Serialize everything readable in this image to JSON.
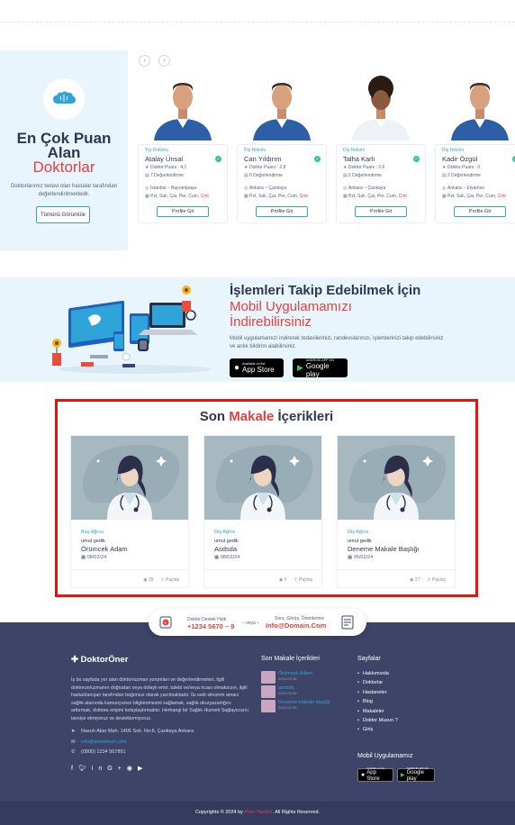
{
  "top_doctors": {
    "title_line1": "En Çok Puan",
    "title_line2": "Alan",
    "title_line3": "Doktorlar",
    "description": "Doktorlarımız tedavi olan hastalar tarafından değerlendirilmektedir.",
    "view_all": "Tümünü Görüntüle",
    "prev_arrow": "‹",
    "next_arrow": "›",
    "doctors": [
      {
        "specialty": "Tıp Doktoru",
        "name": "Atalay Ünsal",
        "score": "Doktor Puanı : 4.1",
        "reviews": "7 Değerlendirme",
        "location": "İstanbul – Bayrampaşa",
        "days": "Pzt, Salı, Çar, Per, Cum,",
        "days_off": "Cmt",
        "button": "Profile Git"
      },
      {
        "specialty": "Diş Hekimi",
        "name": "Can Yıldırım",
        "score": "Doktor Puanı : 2.9",
        "reviews": "0 Değerlendirme",
        "location": "Ankara – Çankaya",
        "days": "Pzt, Salı, Çar, Per, Cum,",
        "days_off": "Cmt",
        "button": "Profile Git"
      },
      {
        "specialty": "Diş Hekimi",
        "name": "Talha Karlı",
        "score": "Doktor Puanı : 2.6",
        "reviews": "2 Değerlendirme",
        "location": "Ankara – Çankaya",
        "days": "Pzt, Salı, Çar, Per, Cum,",
        "days_off": "Cmt",
        "button": "Profile Git"
      },
      {
        "specialty": "Diş Hekimi",
        "name": "Kadir Özgül",
        "score": "Doktor Puanı : 0",
        "reviews": "2 Değerlendirme",
        "location": "Ankara – Etyamon",
        "days": "Pzt, Salı, Çar, Per, Cum,",
        "days_off": "Cmt",
        "button": "Profile Git"
      }
    ]
  },
  "app_promo": {
    "title": "İşlemleri Takip Edebilmek İçin",
    "subtitle": "Mobil Uygulamamızı İndirebilirsiniz",
    "description": "Mobil uygulamamızı indirerek tedavilerinizi, randevularınızı, işlemlerinizi takip edebilirsiniz ve anlık bildirim alabilirsiniz.",
    "app_store_small": "Available on the",
    "app_store": "App Store",
    "google_play_small": "ANDROID APP ON",
    "google_play": "Google play"
  },
  "articles": {
    "title_pre": "Son",
    "title_highlight": "Makale",
    "title_post": "İçerikleri",
    "items": [
      {
        "category": "Baş Ağrısı",
        "author": "umut gedik",
        "title": "Örümcek Adam",
        "date": "08/02/24",
        "views": "39",
        "share": "Paylaş"
      },
      {
        "category": "Diş Ağrısı",
        "author": "umut gedik",
        "title": "Asdsda",
        "date": "08/02/24",
        "views": "0",
        "share": "Paylaş"
      },
      {
        "category": "Diş Ağrısı",
        "author": "umut gedik",
        "title": "Deneme Makale Başlığı",
        "date": "05/02/24",
        "views": "27",
        "share": "Paylaş"
      }
    ]
  },
  "support": {
    "hotline_label": "Doktor Destek Hattı",
    "hotline_number": "+1234 5670 – 9",
    "separator": "– veya –",
    "email_label": "Soru, Görüş, Önerileriniz",
    "email": "Info@Domain.Com"
  },
  "footer": {
    "logo": "DoktorÖner",
    "about": "İş bu sayfada yer alan doktor/uzman yorumları ve değerlendirmeleri, ilgili doktorun/uzmanın doğrudan veya dolaylı emri, talebi ve/veya ricası olmaksızın, ilgili hasta/danışan tarafından bağımsız olarak yazılmaktadır. İlu web sitesinin amacı sağlık alanında kamuoyunun bilgilenmesini sağlamak, sağlık okuryazarlığını arttırmak, doktora erişimi kolaylaştırmaktır. Herhangi bir Sağlık Hizmeti Sağlayıcısını tavsiye etmiyoruz ve desteklemiyoruz.",
    "address": "Nasuh Akar Mah. 1405 Sok. No:6, Çankaya Ankara",
    "contact_email": "info@domainurl.com",
    "phone": "(0800) 1234 567891",
    "recent_title": "Son Makale İçerikleri",
    "recent": [
      {
        "title": "Örümcek Adam",
        "date": "2024-02-08"
      },
      {
        "title": "asdsda",
        "date": "2024-02-08"
      },
      {
        "title": "Deneme makale başlığı",
        "date": "2024-02-05"
      }
    ],
    "pages_title": "Sayfalar",
    "pages": [
      "Hakkımızda",
      "Doktorlar",
      "Hastaneler",
      "Blog",
      "Makaleler",
      "Doktor Musun ?",
      "Giriş"
    ],
    "mobile_title": "Mobil Uygulamamız",
    "copyright_pre": "Copyrights © 2024 by",
    "copyright_brand": "Proo Yazılım",
    "copyright_post": ". All Rights Reserved."
  },
  "colors": {
    "accent_red": "#e2413c",
    "accent_blue": "#2fa4d8",
    "navy": "#3e4467",
    "highlight_box": "#e3160f"
  }
}
